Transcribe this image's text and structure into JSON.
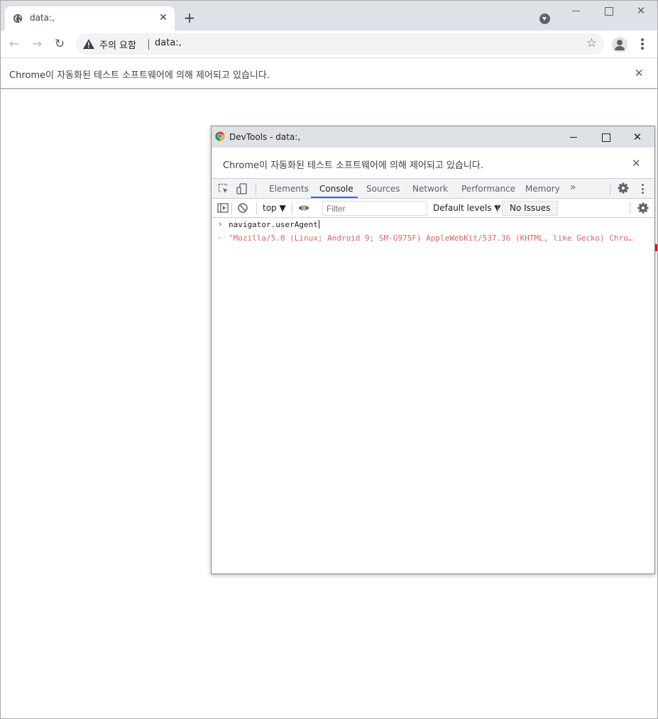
{
  "browser": {
    "tab": {
      "title": "data:,",
      "close": "✕"
    },
    "new_tab": "+",
    "window_close": "✕",
    "nav": {
      "back": "←",
      "forward": "→",
      "reload": "↻"
    },
    "omnibox": {
      "security_label": "주의 요함",
      "url": "data:,",
      "bookmark": "☆"
    },
    "infobar": {
      "message": "Chrome이 자동화된 테스트 소프트웨어에 의해 제어되고 있습니다.",
      "close": "✕"
    }
  },
  "devtools": {
    "window_title": "DevTools - data:,",
    "window_close": "✕",
    "infobar": {
      "message": "Chrome이 자동화된 테스트 소프트웨어에 의해 제어되고 있습니다.",
      "close": "✕"
    },
    "tabs": [
      "Elements",
      "Console",
      "Sources",
      "Network",
      "Performance",
      "Memory"
    ],
    "active_tab": "Console",
    "more_tabs": "»",
    "console_bar": {
      "context": "top ▼",
      "filter_placeholder": "Filter",
      "levels": "Default levels ▼",
      "issues": "No Issues"
    },
    "console": {
      "input_prompt": "›",
      "input": "navigator.userAgent",
      "output_prompt": "‹·",
      "output": "\"Mozilla/5.0 (Linux; Android 9; SM-G975F) AppleWebKit/537.36 (KHTML, like Gecko) Chrom…"
    }
  },
  "colors": {
    "accent": "#1a73e8",
    "output_text": "#c80000",
    "chrome_frame": "#dee1e6"
  }
}
